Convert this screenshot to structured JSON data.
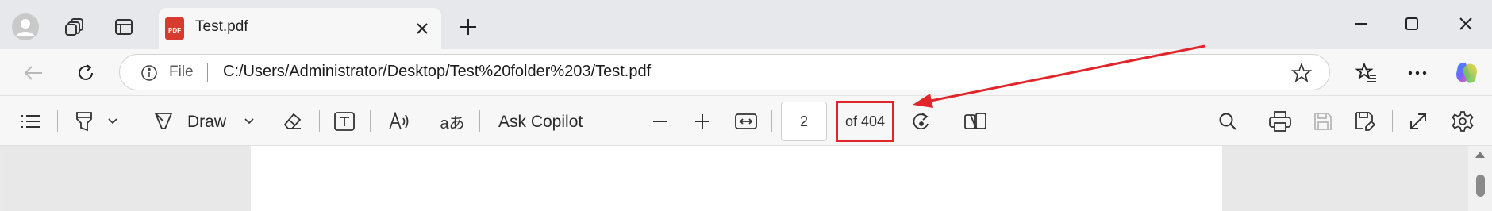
{
  "browser": {
    "tab": {
      "title": "Test.pdf",
      "favicon_text": "PDF"
    },
    "address": {
      "scheme_label": "File",
      "url": "C:/Users/Administrator/Desktop/Test%20folder%203/Test.pdf"
    }
  },
  "pdf_toolbar": {
    "draw_label": "Draw",
    "translate_glyph": "aあ",
    "ask_copilot_label": "Ask Copilot",
    "current_page": "2",
    "total_pages_label": "of 404"
  },
  "colors": {
    "annotation_red": "#e0262a",
    "copilot_accent": "#7b61ff"
  }
}
